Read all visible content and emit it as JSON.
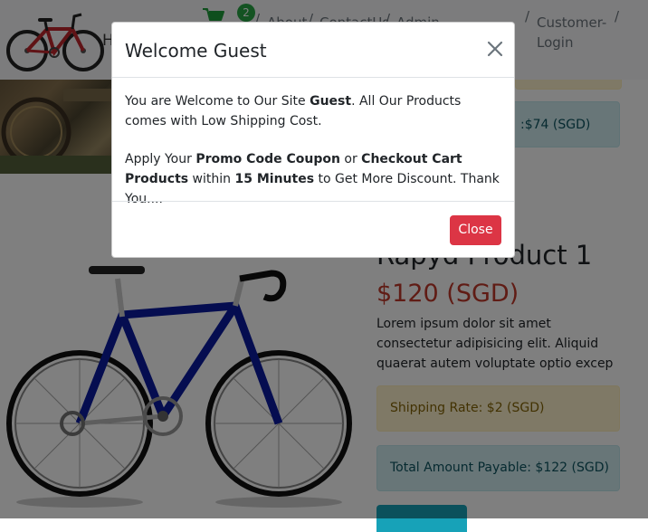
{
  "navbar": {
    "brand_text": "H",
    "cart_count": "2",
    "links": [
      {
        "label": "About"
      },
      {
        "label": "ContactUs"
      },
      {
        "label": "Admin"
      }
    ],
    "customer_login": "Customer-Login",
    "separator": "/"
  },
  "background": {
    "top_info_text": ":$74 (SGD)",
    "product": {
      "title": "Rapyd Product 1",
      "price": "$120 (SGD)",
      "description": "Lorem ipsum dolor sit amet consectetur adipisicing elit. Aliquid quaerat autem voluptate optio excep",
      "shipping": "Shipping Rate: $2 (SGD)",
      "total": "Total Amount Payable: $122 (SGD)"
    }
  },
  "modal": {
    "title": "Welcome Guest",
    "close_x": "×",
    "body": {
      "p1_before": "You are Welcome to Our Site ",
      "p1_bold": "Guest",
      "p1_after": ". All Our Products comes with Low Shipping Cost.",
      "p2_before": "Apply Your ",
      "p2_bold1": "Promo Code Coupon",
      "p2_mid1": " or ",
      "p2_bold2": "Checkout Cart Products",
      "p2_mid2": " within ",
      "p2_bold3": "15 Minutes",
      "p2_after": " to Get More Discount. Thank You...."
    },
    "close_label": "Close"
  },
  "colors": {
    "danger": "#dc3545",
    "success": "#28a745",
    "info_bg": "#d1ecf1",
    "warning_bg": "#fff3cd",
    "price": "#c0392b"
  },
  "icons": [
    "bicycle-logo",
    "cart-icon",
    "close-icon",
    "bicycle-product-image"
  ]
}
